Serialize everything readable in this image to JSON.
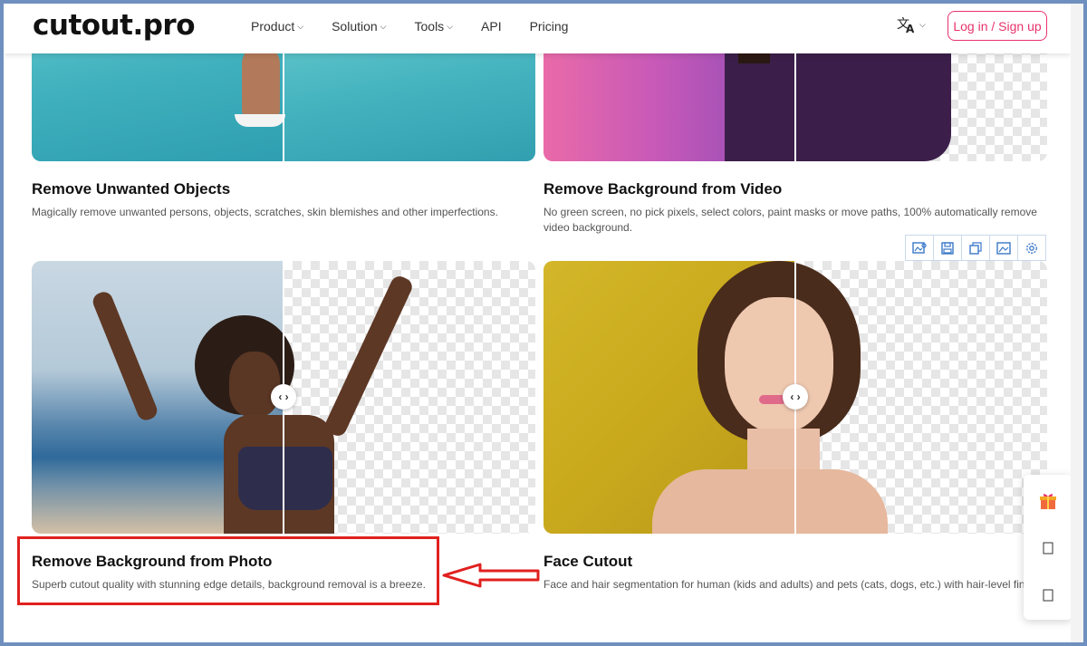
{
  "header": {
    "logo": "cutout.pro",
    "nav": [
      {
        "label": "Product",
        "has_dropdown": true
      },
      {
        "label": "Solution",
        "has_dropdown": true
      },
      {
        "label": "Tools",
        "has_dropdown": true
      },
      {
        "label": "API",
        "has_dropdown": false
      },
      {
        "label": "Pricing",
        "has_dropdown": false
      }
    ],
    "language_icon": "translate-icon",
    "login_label": "Log in / Sign up",
    "accent_color": "#e8336d"
  },
  "cards": {
    "objects": {
      "title": "Remove Unwanted Objects",
      "description": "Magically remove unwanted persons, objects, scratches, skin blemishes and other imperfections."
    },
    "video": {
      "title": "Remove Background from Video",
      "description": "No green screen, no pick pixels, select colors, paint masks or move paths, 100% automatically remove video background."
    },
    "photo": {
      "title": "Remove Background from Photo",
      "description": "Superb cutout quality with stunning edge details, background removal is a breeze."
    },
    "face": {
      "title": "Face Cutout",
      "description": "Face and hair segmentation for human (kids and adults) and pets (cats, dogs, etc.) with hair-level fine details"
    }
  },
  "image_toolbar": [
    "image-search-icon",
    "save-icon",
    "copy-icon",
    "image-icon",
    "settings-icon"
  ],
  "compare_handle": "‹ ›",
  "floating_panel": [
    "gift-icon",
    "square-icon",
    "square-icon"
  ],
  "annotation": {
    "highlight_color": "#e0211f",
    "target": "Remove Background from Photo"
  }
}
